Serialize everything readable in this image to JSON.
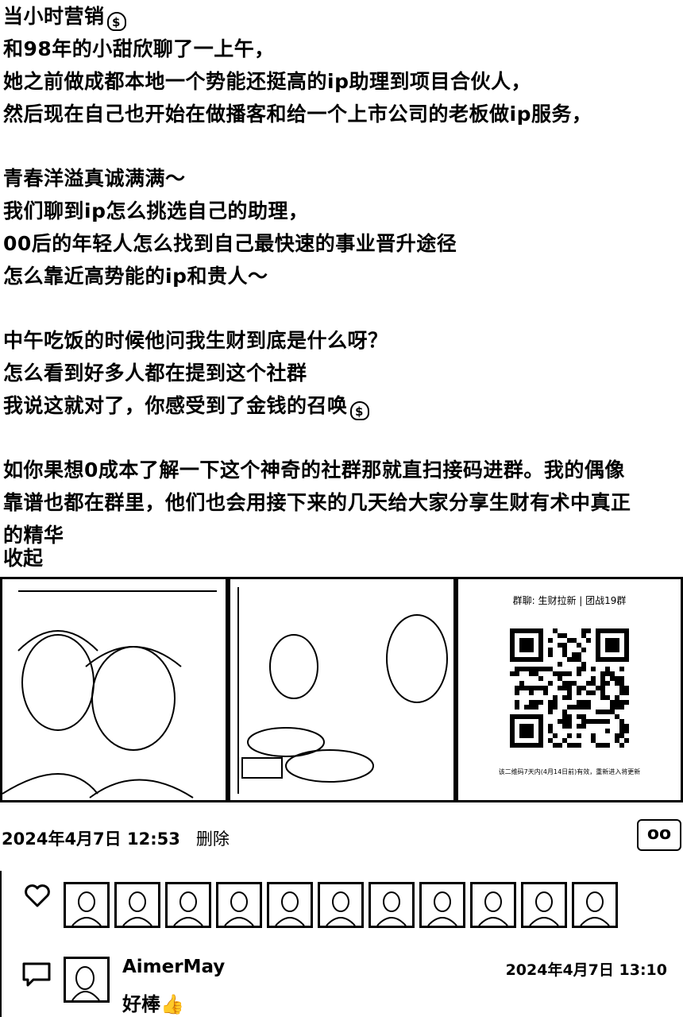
{
  "post": {
    "lines": [
      "当小时营销",
      "和98年的小甜欣聊了一上午，",
      "她之前做成都本地一个势能还挺高的ip助理到项目合伙人，",
      "然后现在自己也开始在做播客和给一个上市公司的老板做ip服务，",
      "",
      "青春洋溢真诚满满～",
      "我们聊到ip怎么挑选自己的助理，",
      "00后的年轻人怎么找到自己最快速的事业晋升途径",
      "怎么靠近高势能的ip和贵人～",
      "",
      "中午吃饭的时候他问我生财到底是什么呀？",
      "怎么看到好多人都在提到这个社群",
      "我说这就对了，你感受到了金钱的召唤",
      "",
      "如你果想0成本了解一下这个神奇的社群那就直扫接码进群。我的偶像",
      "靠谱也都在群里，他们也会用接下来的几天给大家分享生财有术中真正",
      "的精华"
    ],
    "emoji": "$",
    "collapse_label": "收起"
  },
  "images": {
    "qr_title": "群聊: 生财拉新 | 团战19群",
    "qr_footer": "该二维码7天内(4月14日前)有效，重新进入将更新"
  },
  "meta": {
    "timestamp": "2024年4月7日 12:53",
    "delete_label": "删除",
    "more_label": "oo"
  },
  "likes": {
    "count_avatars": 11
  },
  "comment": {
    "author": "AimerMay",
    "time": "2024年4月7日 13:10",
    "text": "好棒👍"
  }
}
